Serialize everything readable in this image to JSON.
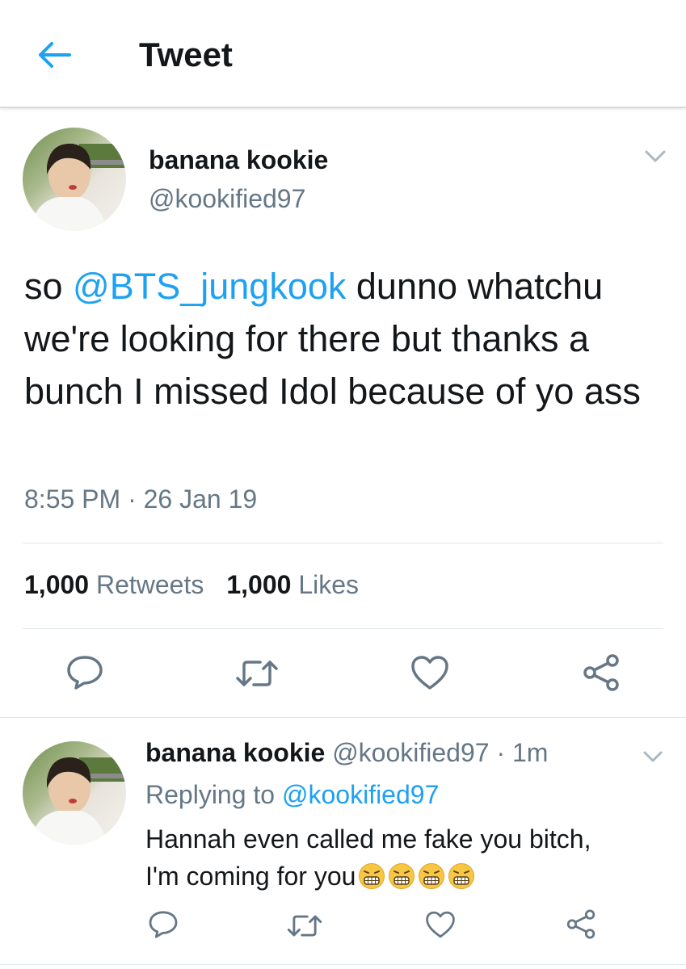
{
  "header": {
    "title": "Tweet",
    "back_icon": "arrow-left-icon",
    "accent": "#1da1f2"
  },
  "main_tweet": {
    "author_name": "banana kookie",
    "author_handle": "@kookified97",
    "text_before": "so ",
    "mention": "@BTS_jungkook",
    "text_after": " dunno whatchu we're looking for there but thanks a bunch I missed Idol because of yo ass",
    "timestamp": "8:55 PM · 26 Jan 19",
    "retweets_count": "1,000",
    "retweets_label": "Retweets",
    "likes_count": "1,000",
    "likes_label": "Likes",
    "actions": [
      "reply-icon",
      "retweet-icon",
      "like-icon",
      "share-icon"
    ]
  },
  "reply": {
    "author_name": "banana kookie",
    "meta": "@kookified97 · 1m",
    "replying_prefix": "Replying to",
    "replying_handle": "@kookified97",
    "text_line1": "Hannah even called me fake you bitch,",
    "text_line2": "I'm coming for you",
    "emojis": [
      "grimacing-face-emoji",
      "grimacing-face-emoji",
      "grimacing-face-emoji",
      "grimacing-face-emoji"
    ],
    "actions": [
      "reply-icon",
      "retweet-icon",
      "like-icon",
      "share-icon"
    ]
  },
  "colors": {
    "text": "#14171a",
    "secondary": "#657786",
    "link": "#1da1f2",
    "divider": "#e1e8ed"
  }
}
